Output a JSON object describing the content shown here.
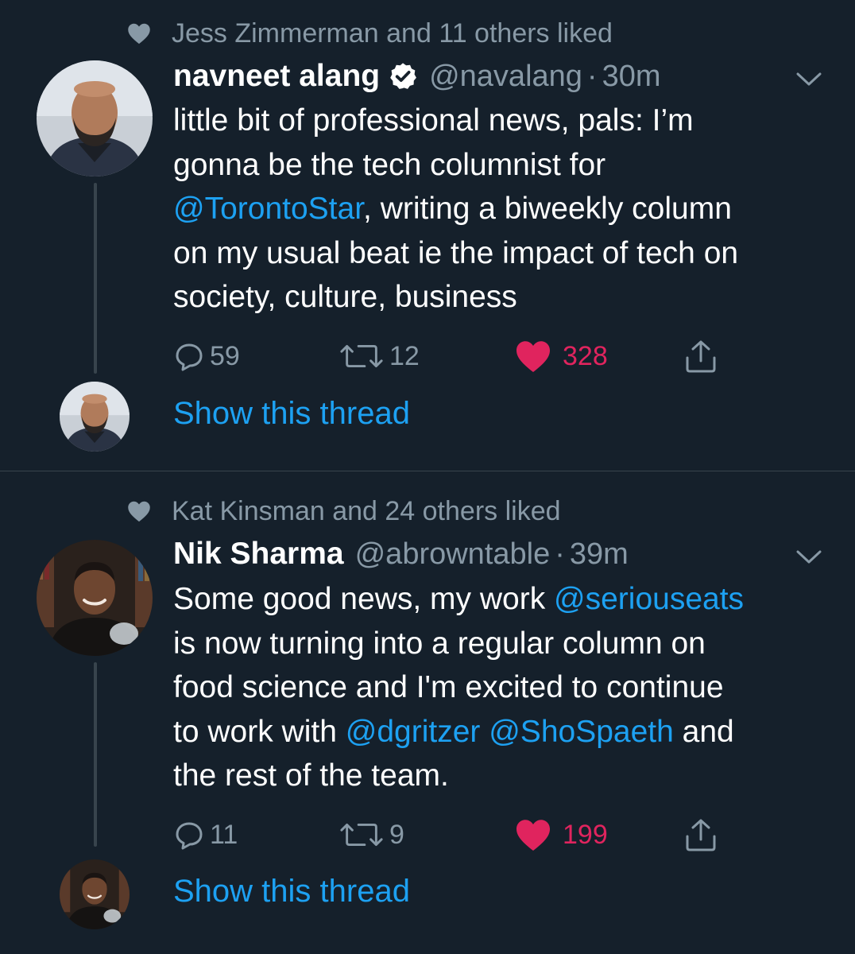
{
  "tweets": [
    {
      "liked_by": "Jess Zimmerman and 11 others liked",
      "name": "navneet alang",
      "verified": true,
      "handle": "@navalang",
      "separator": "·",
      "time": "30m",
      "body_lines": [
        [
          {
            "text": "little bit of professional news, pals: I’m"
          }
        ],
        [
          {
            "text": "gonna be the tech columnist for"
          }
        ],
        [
          {
            "text": "@TorontoStar",
            "mention": true
          },
          {
            "text": ", writing a biweekly column"
          }
        ],
        [
          {
            "text": "on my usual beat ie the impact of tech on"
          }
        ],
        [
          {
            "text": "society, culture, business"
          }
        ]
      ],
      "replies": "59",
      "retweets": "12",
      "likes": "328",
      "liked": true,
      "show_thread": "Show this thread"
    },
    {
      "liked_by": "Kat Kinsman and 24 others liked",
      "name": "Nik Sharma",
      "verified": false,
      "handle": "@abrowntable",
      "separator": "·",
      "time": "39m",
      "body_lines": [
        [
          {
            "text": "Some good news, my work "
          },
          {
            "text": "@seriouseats",
            "mention": true
          }
        ],
        [
          {
            "text": "is now turning into a regular column on"
          }
        ],
        [
          {
            "text": "food science and I'm excited to continue"
          }
        ],
        [
          {
            "text": "to work with  "
          },
          {
            "text": "@dgritzer",
            "mention": true
          },
          {
            "text": " "
          },
          {
            "text": "@ShoSpaeth",
            "mention": true
          },
          {
            "text": " and"
          }
        ],
        [
          {
            "text": "the rest of the team."
          }
        ]
      ],
      "replies": "11",
      "retweets": "9",
      "likes": "199",
      "liked": true,
      "show_thread": "Show this thread"
    }
  ],
  "icons": {
    "liked_indicator": "heart-icon",
    "verified": "verified-badge-icon",
    "menu": "chevron-down-icon",
    "reply": "reply-icon",
    "retweet": "retweet-icon",
    "like": "heart-icon",
    "share": "share-icon"
  },
  "colors": {
    "background": "#15202b",
    "text": "#ffffff",
    "muted": "#8899a6",
    "link": "#1da1f2",
    "like": "#e0245e",
    "divider": "#38444d"
  }
}
